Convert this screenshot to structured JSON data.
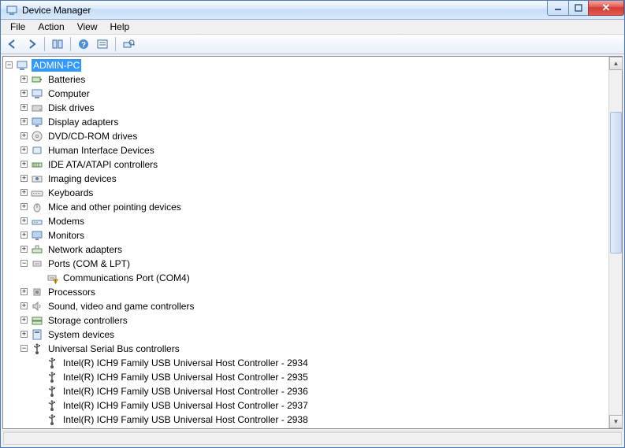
{
  "window": {
    "title": "Device Manager"
  },
  "menu": {
    "items": [
      "File",
      "Action",
      "View",
      "Help"
    ]
  },
  "tree": {
    "root": {
      "label": "ADMIN-PC",
      "expanded": true,
      "selected": true,
      "icon": "computer",
      "children": [
        {
          "label": "Batteries",
          "icon": "battery",
          "expanded": false
        },
        {
          "label": "Computer",
          "icon": "computer",
          "expanded": false
        },
        {
          "label": "Disk drives",
          "icon": "disk",
          "expanded": false
        },
        {
          "label": "Display adapters",
          "icon": "display",
          "expanded": false
        },
        {
          "label": "DVD/CD-ROM drives",
          "icon": "dvd",
          "expanded": false
        },
        {
          "label": "Human Interface Devices",
          "icon": "hid",
          "expanded": false
        },
        {
          "label": "IDE ATA/ATAPI controllers",
          "icon": "ide",
          "expanded": false
        },
        {
          "label": "Imaging devices",
          "icon": "imaging",
          "expanded": false
        },
        {
          "label": "Keyboards",
          "icon": "keyboard",
          "expanded": false
        },
        {
          "label": "Mice and other pointing devices",
          "icon": "mouse",
          "expanded": false
        },
        {
          "label": "Modems",
          "icon": "modem",
          "expanded": false
        },
        {
          "label": "Monitors",
          "icon": "monitor",
          "expanded": false
        },
        {
          "label": "Network adapters",
          "icon": "network",
          "expanded": false
        },
        {
          "label": "Ports (COM & LPT)",
          "icon": "port",
          "expanded": true,
          "children": [
            {
              "label": "Communications Port (COM4)",
              "icon": "port-warn",
              "leaf": true
            }
          ]
        },
        {
          "label": "Processors",
          "icon": "cpu",
          "expanded": false
        },
        {
          "label": "Sound, video and game controllers",
          "icon": "sound",
          "expanded": false
        },
        {
          "label": "Storage controllers",
          "icon": "storage",
          "expanded": false
        },
        {
          "label": "System devices",
          "icon": "system",
          "expanded": false
        },
        {
          "label": "Universal Serial Bus controllers",
          "icon": "usb",
          "expanded": true,
          "children": [
            {
              "label": "Intel(R) ICH9 Family USB Universal Host Controller - 2934",
              "icon": "usb",
              "leaf": true
            },
            {
              "label": "Intel(R) ICH9 Family USB Universal Host Controller - 2935",
              "icon": "usb",
              "leaf": true
            },
            {
              "label": "Intel(R) ICH9 Family USB Universal Host Controller - 2936",
              "icon": "usb",
              "leaf": true
            },
            {
              "label": "Intel(R) ICH9 Family USB Universal Host Controller - 2937",
              "icon": "usb",
              "leaf": true
            },
            {
              "label": "Intel(R) ICH9 Family USB Universal Host Controller - 2938",
              "icon": "usb",
              "leaf": true
            }
          ]
        }
      ]
    }
  }
}
